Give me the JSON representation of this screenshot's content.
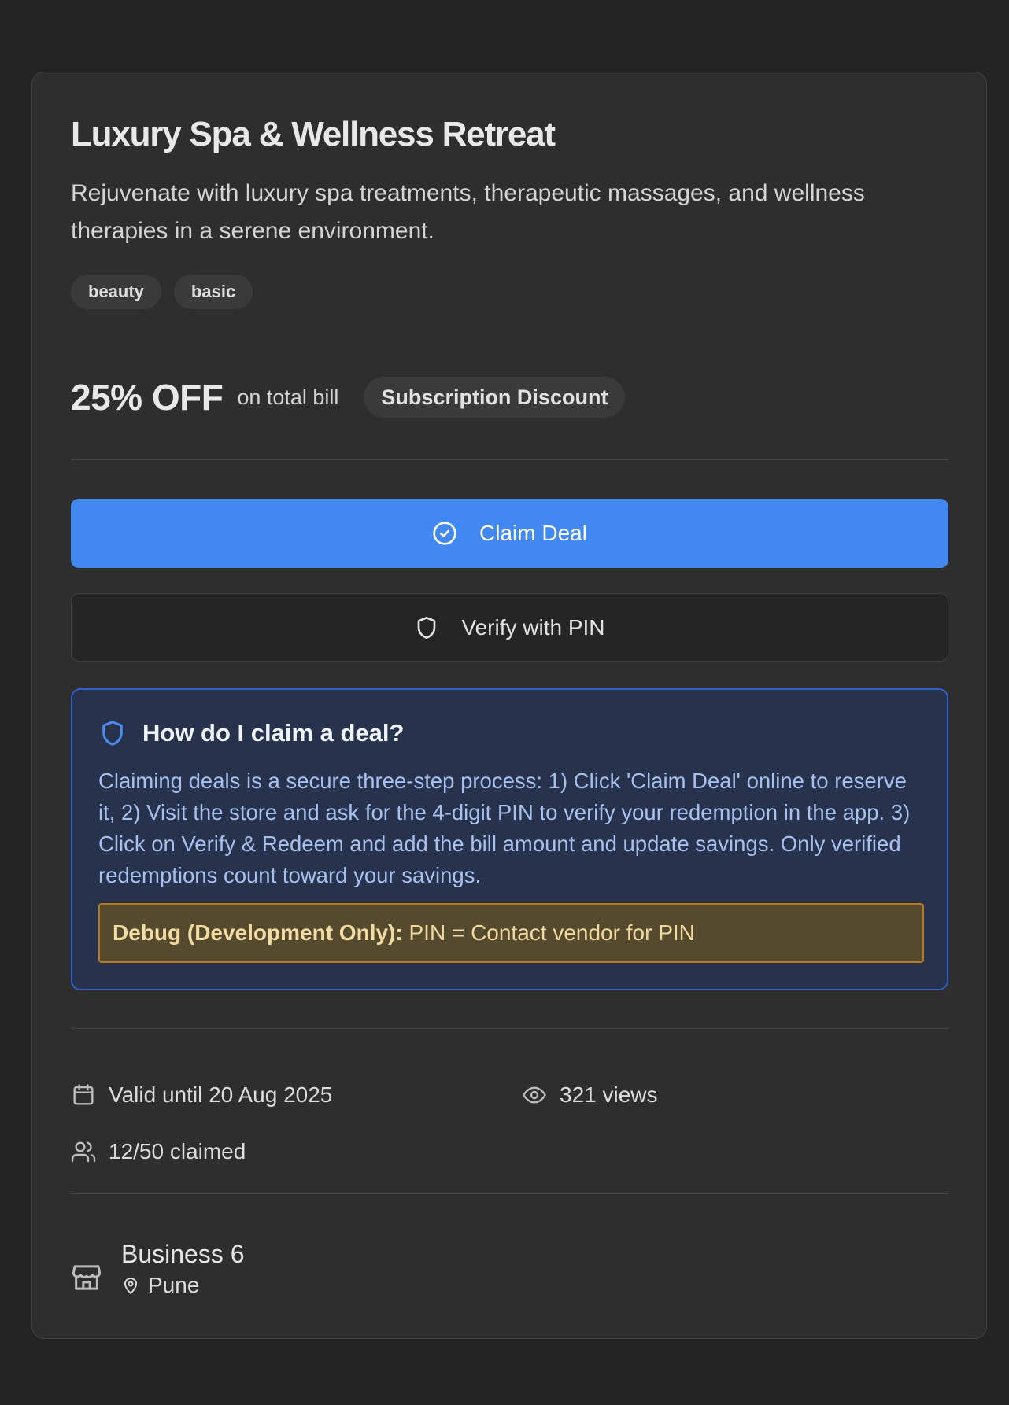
{
  "deal": {
    "title": "Luxury Spa & Wellness Retreat",
    "description": "Rejuvenate with luxury spa treatments, therapeutic massages, and wellness therapies in a serene environment.",
    "tags": [
      "beauty",
      "basic"
    ],
    "offer": {
      "value": "25% OFF",
      "subtext": "on total bill",
      "badge": "Subscription Discount"
    }
  },
  "actions": {
    "claim_label": "Claim Deal",
    "claim_icon": "check-circle-icon",
    "verify_label": "Verify with PIN",
    "verify_icon": "shield-icon"
  },
  "help": {
    "title": "How do I claim a deal?",
    "body": "Claiming deals is a secure three-step process: 1) Click 'Claim Deal' online to reserve it, 2) Visit the store and ask for the 4-digit PIN to verify your redemption in the app. 3) Click on Verify & Redeem and add the bill amount and update savings. Only verified redemptions count toward your savings.",
    "debug_label": "Debug (Development Only):",
    "debug_value": " PIN = Contact vendor for PIN"
  },
  "meta": {
    "valid_until": "Valid until 20 Aug 2025",
    "views": "321 views",
    "claimed": "12/50 claimed"
  },
  "business": {
    "name": "Business 6",
    "location": "Pune"
  },
  "colors": {
    "accent": "#4189f0",
    "card_bg": "#2e2e2e",
    "page_bg": "#242424",
    "help_bg": "#27324c",
    "debug_border": "#b57a22"
  }
}
